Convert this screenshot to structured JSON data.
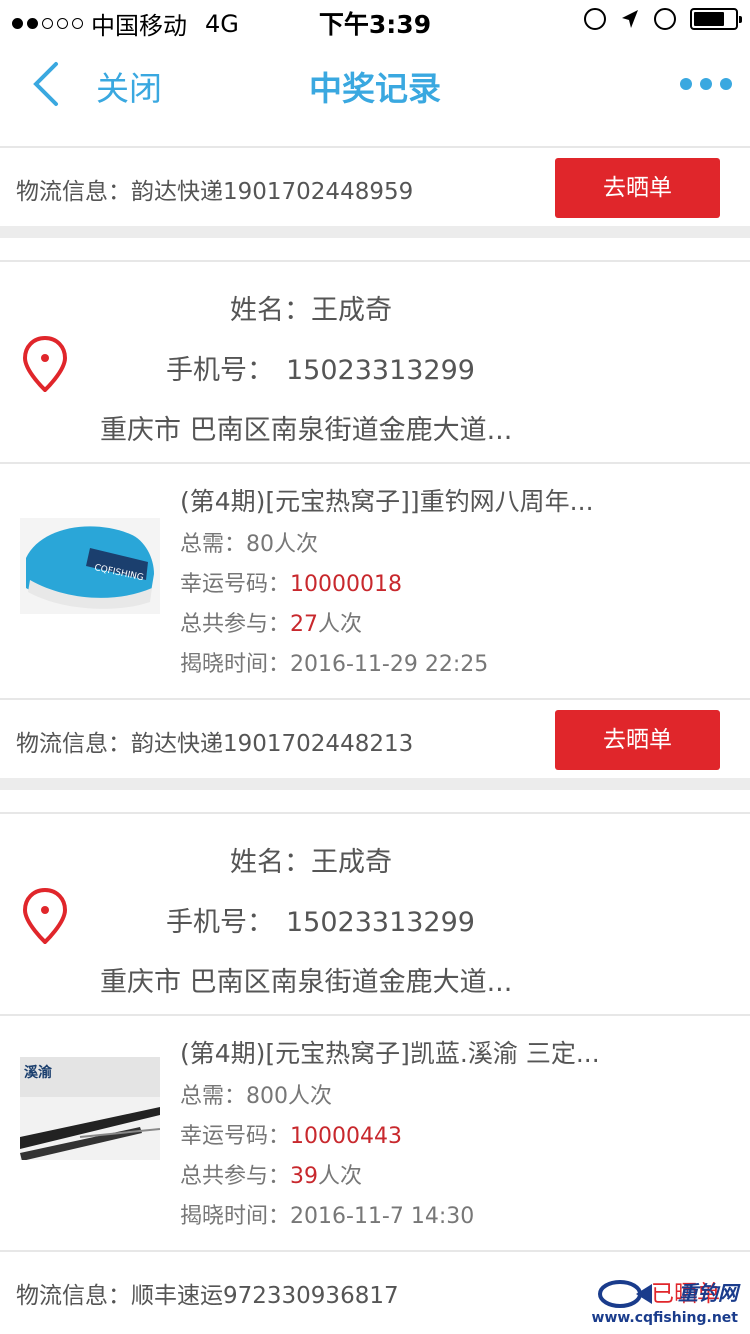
{
  "status_bar": {
    "carrier": "中国移动",
    "network": "4G",
    "time": "下午3:39"
  },
  "nav": {
    "close_label": "关闭",
    "title": "中奖记录"
  },
  "records": [
    {
      "logistics_label": "物流信息：",
      "logistics_value": "韵达快递1901702448959",
      "action_label": "去晒单"
    },
    {
      "name_label": "姓名：",
      "name": "王成奇",
      "phone_label": "手机号：",
      "phone": "15023313299",
      "address": "重庆市 巴南区南泉街道金鹿大道...",
      "product_title": "(第4期)[元宝热窝子]]重钓网八周年...",
      "need_label": "总需：",
      "need": "80人次",
      "lucky_label": "幸运号码：",
      "lucky_number": "10000018",
      "joined_label": "总共参与：",
      "joined_count": "27",
      "joined_unit": "人次",
      "reveal_label": "揭晓时间：",
      "reveal_time": "2016-11-29 22:25",
      "logistics_label": "物流信息：",
      "logistics_value": "韵达快递1901702448213",
      "action_label": "去晒单"
    },
    {
      "name_label": "姓名：",
      "name": "王成奇",
      "phone_label": "手机号：",
      "phone": "15023313299",
      "address": "重庆市 巴南区南泉街道金鹿大道...",
      "product_title": "(第4期)[元宝热窝子]凯蓝.溪渝 三定...",
      "need_label": "总需：",
      "need": "800人次",
      "lucky_label": "幸运号码：",
      "lucky_number": "10000443",
      "joined_label": "总共参与：",
      "joined_count": "39",
      "joined_unit": "人次",
      "reveal_label": "揭晓时间：",
      "reveal_time": "2016-11-7 14:30",
      "logistics_label": "物流信息：",
      "logistics_value": "顺丰速运972330936817",
      "action_label": "已晒单"
    }
  ],
  "watermark": {
    "text": "重钓网",
    "url": "www.cqfishing.net"
  },
  "colors": {
    "accent": "#3aa8e0",
    "button": "#e0262b",
    "highlight": "#c8282d"
  }
}
